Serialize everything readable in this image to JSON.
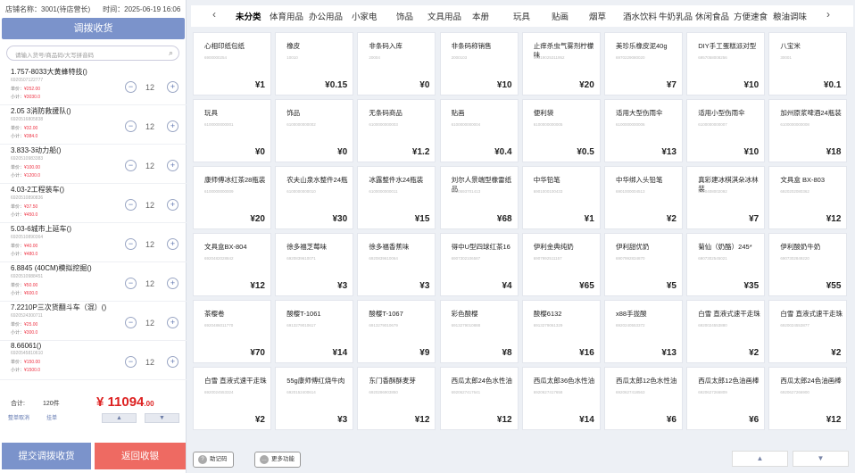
{
  "header": {
    "store": "店铺名称：3001(待店营长)",
    "time": "时间：2025-06-19 16:06"
  },
  "panel_title": "调拨收货",
  "search_placeholder": "请输入货号/商品码/大写拼音码",
  "cart": [
    {
      "name": "1.757-8033大黄蜂特技()",
      "code": "6920507122777",
      "price_label": "单价：",
      "price": "¥252.00",
      "sub_label": "小计：",
      "subtotal": "¥3030.0",
      "qty": "12"
    },
    {
      "name": "2.05 3消防救援队()",
      "code": "6920516805838",
      "price_label": "单价：",
      "price": "¥32.00",
      "sub_label": "小计：",
      "subtotal": "¥384.0",
      "qty": "12"
    },
    {
      "name": "3.833-3动力船()",
      "code": "6920510983383",
      "price_label": "单价：",
      "price": "¥100.00",
      "sub_label": "小计：",
      "subtotal": "¥1200.0",
      "qty": "12"
    },
    {
      "name": "4.03-2工程装车()",
      "code": "6920510890836",
      "price_label": "单价：",
      "price": "¥37.50",
      "sub_label": "小计：",
      "subtotal": "¥450.0",
      "qty": "12"
    },
    {
      "name": "5.03-6城市上延车()",
      "code": "6920510890364",
      "price_label": "单价：",
      "price": "¥40.00",
      "sub_label": "小计：",
      "subtotal": "¥480.0",
      "qty": "12"
    },
    {
      "name": "6.8845 (40CM)模拟挖掘()",
      "code": "6920510988451",
      "price_label": "单价：",
      "price": "¥50.00",
      "sub_label": "小计：",
      "subtotal": "¥600.0",
      "qty": "12"
    },
    {
      "name": "7.2210P三次货翻斗车（混）()",
      "code": "6920524300711",
      "price_label": "单价：",
      "price": "¥25.00",
      "sub_label": "小计：",
      "subtotal": "¥300.0",
      "qty": "12"
    },
    {
      "name": "8.66061()",
      "code": "6920545810610",
      "price_label": "单价：",
      "price": "¥150.00",
      "sub_label": "小计：",
      "subtotal": "¥1500.0",
      "qty": "12"
    }
  ],
  "summary": {
    "label": "合计:",
    "count": "120件",
    "currency": "¥",
    "total": "11094",
    "decimals": ".00"
  },
  "tools": {
    "left": "整单取消",
    "right": "挂单",
    "up": "▲",
    "down": "▼"
  },
  "buttons": {
    "submit": "提交调拨收货",
    "back": "返回收银"
  },
  "categories": {
    "prev": "‹",
    "next": "›",
    "items": [
      "未分类",
      "体育用品",
      "办公用品",
      "小家电",
      "饰品",
      "文具用品",
      "本册",
      "玩具",
      "贴画",
      "烟草",
      "酒水饮料",
      "牛奶乳品",
      "休闲食品",
      "方便速食",
      "粮油调味"
    ],
    "active": 0
  },
  "products": [
    {
      "name": "心相印纸包纸",
      "code": "6900000254",
      "price": "¥1"
    },
    {
      "name": "橡皮",
      "code": "10010",
      "price": "¥0.15"
    },
    {
      "name": "非条码入库",
      "code": "20004",
      "price": "¥0"
    },
    {
      "name": "非条码称销售",
      "code": "2000103",
      "price": "¥10"
    },
    {
      "name": "止痒杀虫气雾剂柠檬味",
      "code": "69519025311952",
      "price": "¥20"
    },
    {
      "name": "美珍乐橡皮泥40g",
      "code": "6970229080020",
      "price": "¥7"
    },
    {
      "name": "DIY手工蛋糕派对型",
      "code": "6957058008256",
      "price": "¥10"
    },
    {
      "name": "八宝米",
      "code": "30001",
      "price": "¥0.1"
    },
    {
      "name": "玩具",
      "code": "6100000000001",
      "price": "¥0"
    },
    {
      "name": "饰品",
      "code": "6100000000002",
      "price": "¥0"
    },
    {
      "name": "无条码商品",
      "code": "6100000000003",
      "price": "¥1.2"
    },
    {
      "name": "贴画",
      "code": "6100000000004",
      "price": "¥0.4"
    },
    {
      "name": "便利袋",
      "code": "6100000000005",
      "price": "¥0.5"
    },
    {
      "name": "适用大型伤雨伞",
      "code": "6100000000006",
      "price": "¥13"
    },
    {
      "name": "适用小型伤雨伞",
      "code": "6100000000007",
      "price": "¥10"
    },
    {
      "name": "加州原浆啤酒24瓶装",
      "code": "6100000000008",
      "price": "¥18"
    },
    {
      "name": "康师傅冰红茶28瓶装",
      "code": "6100000000009",
      "price": "¥20"
    },
    {
      "name": "农夫山泉水整件24瓶",
      "code": "6100000000010",
      "price": "¥30"
    },
    {
      "name": "冰露整件水24瓶装",
      "code": "6100000000011",
      "price": "¥15"
    },
    {
      "name": "刘尔人景端型橡雷纸品",
      "code": "6920593701413",
      "price": "¥68"
    },
    {
      "name": "中华铅笔",
      "code": "6901000100433",
      "price": "¥1"
    },
    {
      "name": "中华绑入头铅笔",
      "code": "6901000004513",
      "price": "¥2"
    },
    {
      "name": "真彩建冰棋淇朵冰林装",
      "code": "6920408002092",
      "price": "¥7"
    },
    {
      "name": "文具盒 BX-803",
      "code": "6920202080362",
      "price": "¥12"
    },
    {
      "name": "文具盒BX-804",
      "code": "6920482028842",
      "price": "¥12"
    },
    {
      "name": "徐多福芝莓味",
      "code": "6920839610071",
      "price": "¥3"
    },
    {
      "name": "徐多福香蕉味",
      "code": "6920839610064",
      "price": "¥3"
    },
    {
      "name": "得中U型四球红茶16",
      "code": "6907302106587",
      "price": "¥4"
    },
    {
      "name": "伊利金典纯奶",
      "code": "6907992511157",
      "price": "¥65"
    },
    {
      "name": "伊利甜优奶",
      "code": "6907992834870",
      "price": "¥5"
    },
    {
      "name": "菊仙（奶酪）245*",
      "code": "6907302545021",
      "price": "¥35"
    },
    {
      "name": "伊利酸奶牛奶",
      "code": "6907302849220",
      "price": "¥55"
    },
    {
      "name": "茶樱卷",
      "code": "6920486011770",
      "price": "¥70"
    },
    {
      "name": "酸樱T-1061",
      "code": "6913279010617",
      "price": "¥14"
    },
    {
      "name": "酸樱T-1067",
      "code": "6913279010679",
      "price": "¥9"
    },
    {
      "name": "彩色酸樱",
      "code": "6913279010888",
      "price": "¥8"
    },
    {
      "name": "酸樱6132",
      "code": "6913279061329",
      "price": "¥16"
    },
    {
      "name": "x88手拢酸",
      "code": "6920240553372",
      "price": "¥13"
    },
    {
      "name": "白雪 直液式速干走珠",
      "code": "6920024553880",
      "price": "¥2"
    },
    {
      "name": "白雪 直液式速干走珠",
      "code": "6920024553877",
      "price": "¥2"
    },
    {
      "name": "白雪 直液式速干走珠",
      "code": "6920024553324",
      "price": "¥2"
    },
    {
      "name": "55g康师傅红烧牛肉",
      "code": "6920152400614",
      "price": "¥3"
    },
    {
      "name": "东门香酥酥麦芽",
      "code": "6920286903850",
      "price": "¥12"
    },
    {
      "name": "西瓜太郎24色水性油",
      "code": "6920627417641",
      "price": "¥12"
    },
    {
      "name": "西瓜太郎36色水性油",
      "code": "6920627417658",
      "price": "¥14"
    },
    {
      "name": "西瓜太郎12色水性油",
      "code": "6920627418563",
      "price": "¥6"
    },
    {
      "name": "西瓜太郎12色油画棒",
      "code": "6920627266809",
      "price": "¥6"
    },
    {
      "name": "西瓜太郎24色油画棒",
      "code": "6920627266900",
      "price": "¥12"
    }
  ],
  "bottom": {
    "help": "助记码",
    "more": "更多功能",
    "page_up": "▲",
    "page_down": "▼",
    "help_icon": "help-icon",
    "more_icon": "more-icon"
  }
}
